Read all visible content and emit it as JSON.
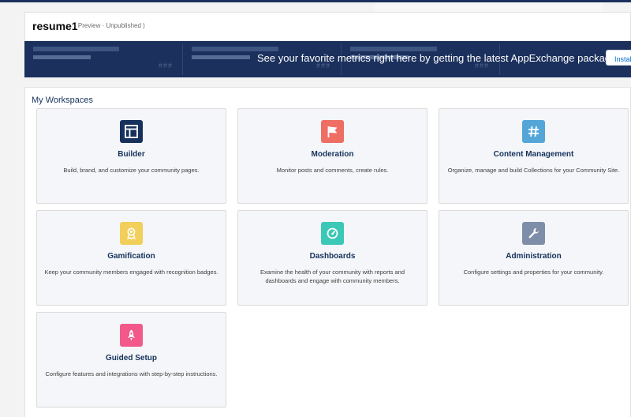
{
  "header": {
    "site_name": "resume1",
    "site_status": "( Preview · Unpublished )"
  },
  "banner": {
    "placeholder_values": [
      "###",
      "###",
      "###"
    ],
    "message": "See your favorite metrics right here by getting the latest AppExchange package.",
    "install_label": "Install"
  },
  "workspaces": {
    "heading": "My Workspaces",
    "tiles": [
      {
        "title": "Builder",
        "description": "Build, brand, and customize your community pages.",
        "icon": "builder-icon",
        "color": "#16325c"
      },
      {
        "title": "Moderation",
        "description": "Monitor posts and comments, create rules.",
        "icon": "flag-icon",
        "color": "#ef6e64"
      },
      {
        "title": "Content Management",
        "description": "Organize, manage and build Collections for your Community Site.",
        "icon": "hash-icon",
        "color": "#54a6d8"
      },
      {
        "title": "Gamification",
        "description": "Keep your community members engaged with recognition badges.",
        "icon": "badge-icon",
        "color": "#f2cf5b"
      },
      {
        "title": "Dashboards",
        "description": "Examine the health of your community with reports and dashboards and engage with community members.",
        "icon": "gauge-icon",
        "color": "#3bc8b6"
      },
      {
        "title": "Administration",
        "description": "Configure settings and properties for your community.",
        "icon": "wrench-icon",
        "color": "#7f8ea8"
      },
      {
        "title": "Guided Setup",
        "description": "Configure features and integrations with step-by-step instructions.",
        "icon": "rocket-icon",
        "color": "#f2598a"
      }
    ]
  }
}
